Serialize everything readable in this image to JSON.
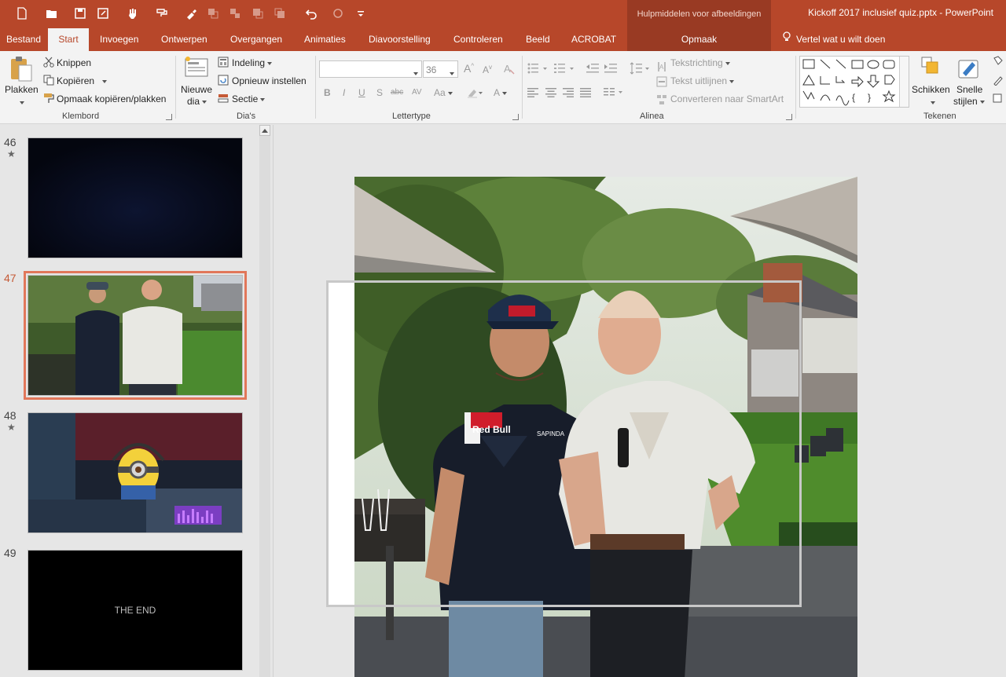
{
  "window": {
    "doc_title": "Kickoff 2017 inclusief quiz.pptx  -  PowerPoint",
    "contextual_group": "Hulpmiddelen voor afbeeldingen"
  },
  "quick_access": [
    "new-icon",
    "open-icon",
    "save-icon",
    "save-as-icon",
    "touch-mode-icon",
    "format-painter-qat-icon",
    "brush-icon",
    "group-icon",
    "ungroup-icon",
    "bring-forward-icon",
    "send-backward-icon",
    "undo-icon",
    "redo-icon",
    "customize-icon"
  ],
  "tabs": [
    "Bestand",
    "Start",
    "Invoegen",
    "Ontwerpen",
    "Overgangen",
    "Animaties",
    "Diavoorstelling",
    "Controleren",
    "Beeld",
    "ACROBAT"
  ],
  "active_tab": "Start",
  "contextual_tab": "Opmaak",
  "tell_me": "Vertel wat u wilt doen",
  "ribbon": {
    "clipboard": {
      "paste": "Plakken",
      "cut": "Knippen",
      "copy": "Kopiëren",
      "format_painter": "Opmaak kopiëren/plakken",
      "label": "Klembord"
    },
    "slides": {
      "new_slide_1": "Nieuwe",
      "new_slide_2": "dia",
      "layout": "Indeling",
      "reset": "Opnieuw instellen",
      "section": "Sectie",
      "label": "Dia's"
    },
    "font": {
      "font_size": "36",
      "label": "Lettertype"
    },
    "paragraph": {
      "text_direction": "Tekstrichting",
      "align_text": "Tekst uitlijnen",
      "smartart": "Converteren naar SmartArt",
      "label": "Alinea"
    },
    "drawing": {
      "arrange": "Schikken",
      "quick_styles_1": "Snelle",
      "quick_styles_2": "stijlen",
      "label": "Tekenen"
    }
  },
  "slides": [
    {
      "number": "46",
      "star": "★",
      "kind": "dark"
    },
    {
      "number": "47",
      "star": "",
      "kind": "photo",
      "selected": true
    },
    {
      "number": "48",
      "star": "★",
      "kind": "minion"
    },
    {
      "number": "49",
      "star": "",
      "kind": "end",
      "text": "THE END"
    }
  ],
  "colors": {
    "accent": "#b7472a",
    "accent_dark": "#993a23",
    "selection": "#e1775a"
  }
}
